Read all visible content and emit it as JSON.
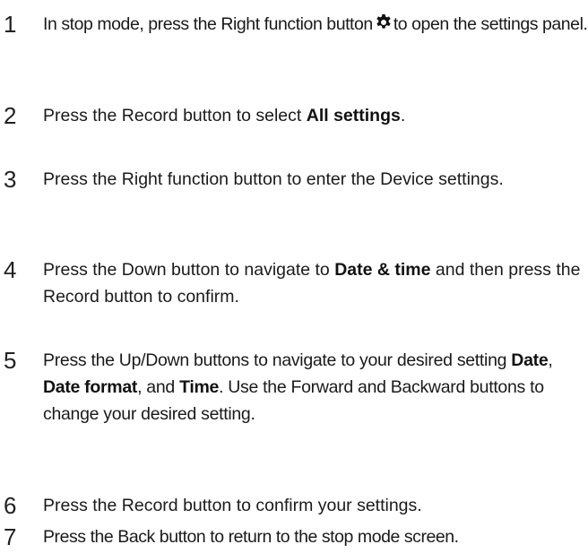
{
  "steps": [
    {
      "number": "1",
      "before_icon": "In stop mode, press the Right function button",
      "icon": "gear-icon",
      "after_icon": "to open the settings panel."
    },
    {
      "number": "2",
      "text_a": "Press the Record button to select ",
      "bold_a": "All settings",
      "text_b": "."
    },
    {
      "number": "3",
      "text": "Press the Right function button to enter the Device settings."
    },
    {
      "number": "4",
      "text_a": "Press the Down button to navigate to ",
      "bold_a": "Date & time",
      "text_b": " and then press the Record button to confirm."
    },
    {
      "number": "5",
      "text_a": "Press the Up/Down buttons to navigate to your desired setting ",
      "bold_a": "Date",
      "text_b": ", ",
      "bold_b": "Date format",
      "text_c": ", and ",
      "bold_c": "Time",
      "text_d": ". Use the Forward and Backward buttons to change your desired setting."
    },
    {
      "number": "6",
      "text": "Press the Record button to confirm your settings."
    },
    {
      "number": "7",
      "text": "Press the Back button to return to the stop mode screen."
    }
  ]
}
